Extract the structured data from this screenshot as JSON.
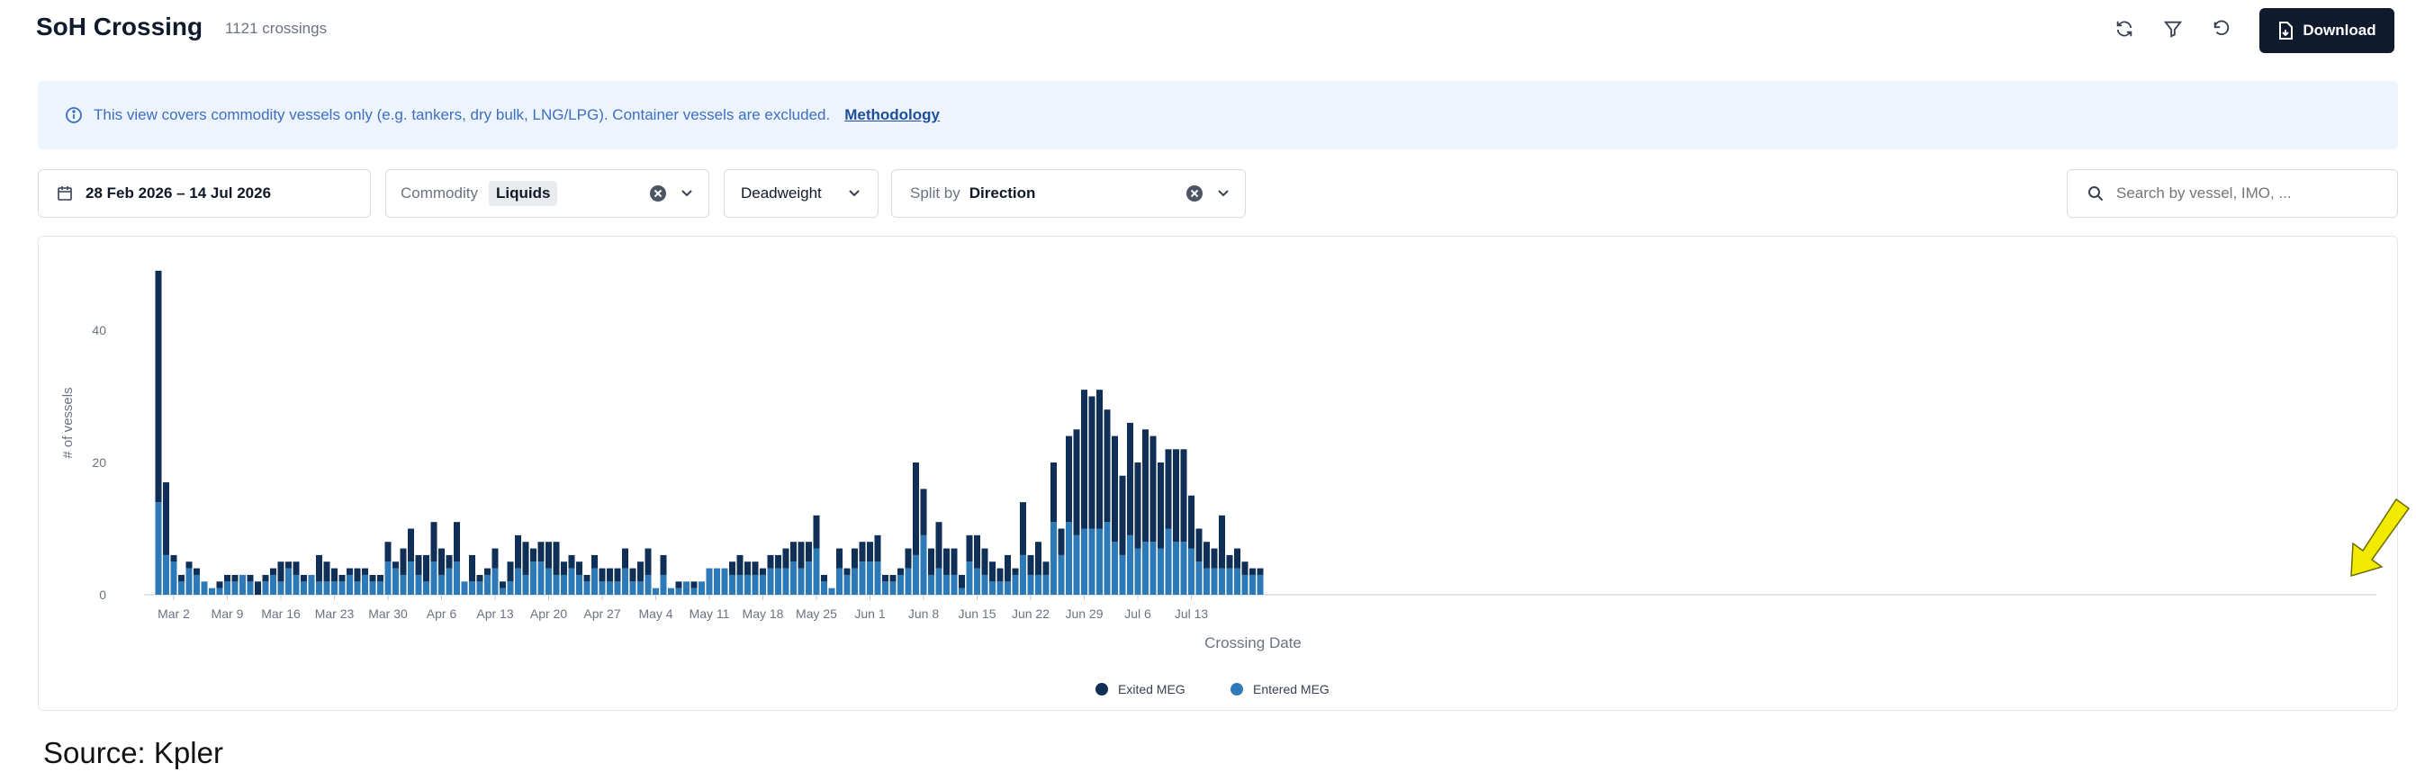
{
  "header": {
    "title": "SoH Crossing",
    "count_label": "1121 crossings",
    "download_label": "Download"
  },
  "info_banner": {
    "text": "This view covers commodity vessels only (e.g. tankers, dry bulk, LNG/LPG). Container vessels are excluded.",
    "link_label": "Methodology"
  },
  "filters": {
    "date_range": "28 Feb 2026 – 14 Jul 2026",
    "commodity_label": "Commodity",
    "commodity_value": "Liquids",
    "deadweight_label": "Deadweight",
    "split_label": "Split by",
    "split_value": "Direction",
    "search_placeholder": "Search by vessel, IMO, ..."
  },
  "source_note": "Source: Kpler",
  "colors": {
    "exited": "#0f2f57",
    "entered": "#2e7ab8",
    "accent_dark": "#0f1b2d",
    "arrow": "#f2ea00"
  },
  "chart_data": {
    "type": "bar",
    "stacked": true,
    "xlabel": "Crossing Date",
    "ylabel": "# of vessels",
    "ylim": [
      0,
      50
    ],
    "yticks": [
      0,
      20,
      40
    ],
    "start_date": "2026-02-28",
    "x_tick_labels": [
      "Mar 2",
      "Mar 9",
      "Mar 16",
      "Mar 23",
      "Mar 30",
      "Apr 6",
      "Apr 13",
      "Apr 20",
      "Apr 27",
      "May 4",
      "May 11",
      "May 18",
      "May 25",
      "Jun 1",
      "Jun 8",
      "Jun 15",
      "Jun 22",
      "Jun 29",
      "Jul 6",
      "Jul 13"
    ],
    "legend": [
      "Exited MEG",
      "Entered MEG"
    ],
    "legend_position": "bottom",
    "series": [
      {
        "name": "Exited MEG",
        "values": [
          35,
          11,
          1,
          1,
          1,
          1,
          0,
          0,
          1,
          1,
          1,
          0,
          1,
          2,
          1,
          1,
          3,
          1,
          2,
          1,
          0,
          4,
          3,
          2,
          1,
          1,
          2,
          1,
          1,
          1,
          3,
          1,
          4,
          5,
          3,
          4,
          6,
          4,
          2,
          6,
          0,
          4,
          1,
          1,
          3,
          1,
          3,
          5,
          5,
          2,
          3,
          4,
          5,
          2,
          2,
          2,
          1,
          2,
          2,
          2,
          2,
          3,
          2,
          3,
          4,
          0,
          3,
          0,
          1,
          0,
          1,
          0,
          0,
          0,
          0,
          2,
          3,
          2,
          2,
          1,
          2,
          2,
          3,
          3,
          4,
          3,
          5,
          1,
          0,
          3,
          1,
          3,
          3,
          3,
          4,
          1,
          1,
          1,
          3,
          14,
          7,
          4,
          7,
          4,
          4,
          2,
          4,
          5,
          4,
          3,
          2,
          4,
          1,
          8,
          3,
          5,
          2,
          9,
          4,
          13,
          16,
          21,
          20,
          21,
          17,
          16,
          12,
          17,
          13,
          17,
          16,
          13,
          12,
          14,
          14,
          8,
          5,
          4,
          3,
          8,
          2,
          3,
          2,
          1,
          1
        ]
      },
      {
        "name": "Entered MEG",
        "values": [
          14,
          6,
          5,
          2,
          4,
          3,
          2,
          1,
          1,
          2,
          2,
          3,
          2,
          0,
          2,
          3,
          2,
          4,
          3,
          2,
          3,
          2,
          2,
          2,
          2,
          3,
          2,
          3,
          2,
          2,
          5,
          4,
          3,
          5,
          3,
          2,
          5,
          3,
          4,
          5,
          2,
          2,
          2,
          3,
          4,
          1,
          2,
          4,
          3,
          5,
          5,
          4,
          3,
          3,
          4,
          3,
          2,
          4,
          2,
          2,
          2,
          4,
          2,
          2,
          3,
          1,
          3,
          1,
          1,
          2,
          1,
          2,
          4,
          4,
          4,
          3,
          3,
          3,
          3,
          3,
          4,
          4,
          4,
          5,
          4,
          5,
          7,
          2,
          1,
          4,
          3,
          4,
          5,
          5,
          5,
          2,
          2,
          3,
          4,
          6,
          9,
          3,
          4,
          3,
          3,
          1,
          5,
          4,
          3,
          2,
          2,
          2,
          3,
          6,
          3,
          3,
          3,
          11,
          6,
          11,
          9,
          10,
          10,
          10,
          11,
          8,
          6,
          9,
          7,
          8,
          8,
          7,
          10,
          8,
          8,
          7,
          5,
          4,
          4,
          4,
          4,
          4,
          3,
          3,
          3
        ]
      }
    ]
  }
}
